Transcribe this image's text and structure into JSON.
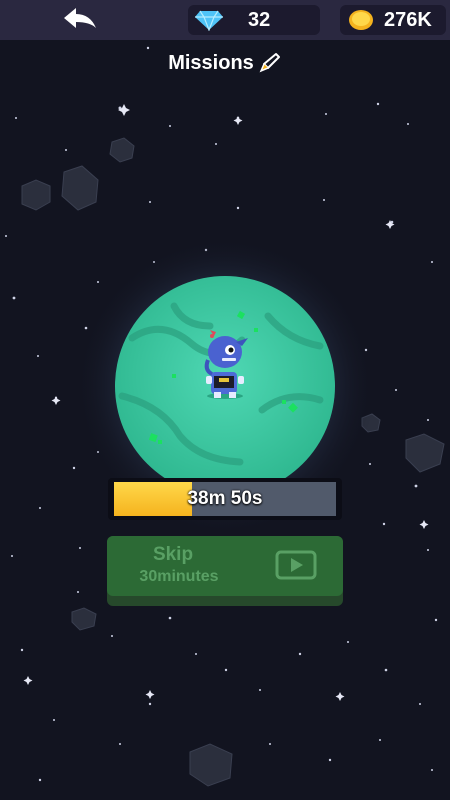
{
  "header": {
    "gems": "32",
    "coins": "276K"
  },
  "title": "Missions",
  "progress": {
    "label": "38m 50s",
    "fraction": 0.35
  },
  "skip": {
    "line1": "Skip",
    "line2": "30minutes"
  },
  "icons": {
    "back": "back-arrow-icon",
    "gem": "diamond-icon",
    "coin": "coin-icon",
    "title": "rocket-icon",
    "video": "video-play-icon"
  },
  "colors": {
    "background": "#121420",
    "topbar": "#2a2840",
    "planet": "#3ec9a4",
    "progress_fill": "#f5b31e",
    "skip_button": "#2c6a35"
  }
}
